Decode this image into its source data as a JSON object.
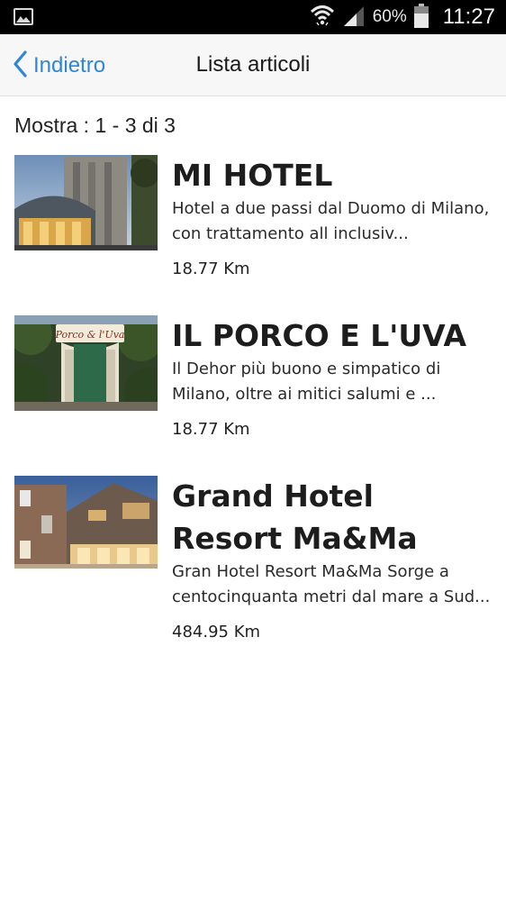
{
  "status_bar": {
    "battery_percent": "60%",
    "time": "11:27",
    "icons": [
      "gallery-icon",
      "wifi-icon",
      "signal-icon",
      "battery-icon"
    ]
  },
  "nav": {
    "back_label": "Indietro",
    "title": "Lista articoli",
    "accent_color": "#2f86d6"
  },
  "list": {
    "count_label": "Mostra : 1 - 3 di 3",
    "items": [
      {
        "title": "MI HOTEL",
        "description": "Hotel a due passi dal Duomo di Milano, con trattamento all inclusiv...",
        "distance": "18.77 Km"
      },
      {
        "title": "IL PORCO E L'UVA",
        "description": "Il Dehor più buono e simpatico di Milano, oltre ai mitici salumi e ...",
        "distance": "18.77 Km",
        "sign_text": "Porco & l'Uva"
      },
      {
        "title": "Grand Hotel Resort Ma&Ma",
        "description": "Gran Hotel Resort Ma&Ma Sorge a centocinquanta metri dal mare a Sud...",
        "distance": "484.95 Km"
      }
    ]
  }
}
